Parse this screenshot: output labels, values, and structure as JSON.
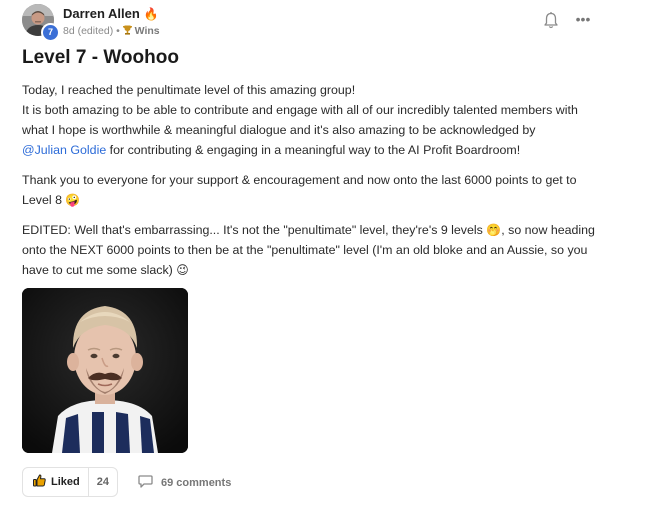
{
  "author": {
    "name": "Darren Allen",
    "flair": "🔥",
    "level": "7",
    "time": "8d (edited)",
    "separator": "•",
    "category_icon": "trophy-icon",
    "category": "Wins"
  },
  "post": {
    "title": "Level 7 - Woohoo",
    "paragraph1": {
      "line1": "Today, I reached the penultimate level of this amazing group!",
      "line2": "It is both amazing to be able to contribute and engage with all of our incredibly talented members with",
      "line3": "what I hope is worthwhile & meaningful dialogue and it's also amazing to be acknowledged by",
      "mention": "@Julian Goldie",
      "line4_rest": " for contributing & engaging in a meaningful way to the AI Profit Boardroom!"
    },
    "paragraph2": {
      "line1": "Thank you to everyone for your support & encouragement and now onto the last 6000 points to get to",
      "line2": "Level 8",
      "emoji": "🤪"
    },
    "paragraph3": {
      "line1_a": "EDITED: Well that's embarrassing... It's not the \"penultimate\" level, they're's 9 levels",
      "line1_emoji": "🤭",
      "line1_b": ", so now heading",
      "line2": "onto the NEXT 6000 points to then be at the \"penultimate\" level (I'm an old bloke and an Aussie, so you",
      "line3": "have to cut me some slack)",
      "line3_emoji": "😉"
    }
  },
  "actions": {
    "notification_icon": "bell-icon",
    "more_icon": "more-options-icon",
    "more_label": "•••"
  },
  "footer": {
    "like_label": "Liked",
    "like_count": "24",
    "comments_label": "69 comments"
  },
  "colors": {
    "mention": "#2c6bd8",
    "level_badge": "#3b6fd6"
  }
}
